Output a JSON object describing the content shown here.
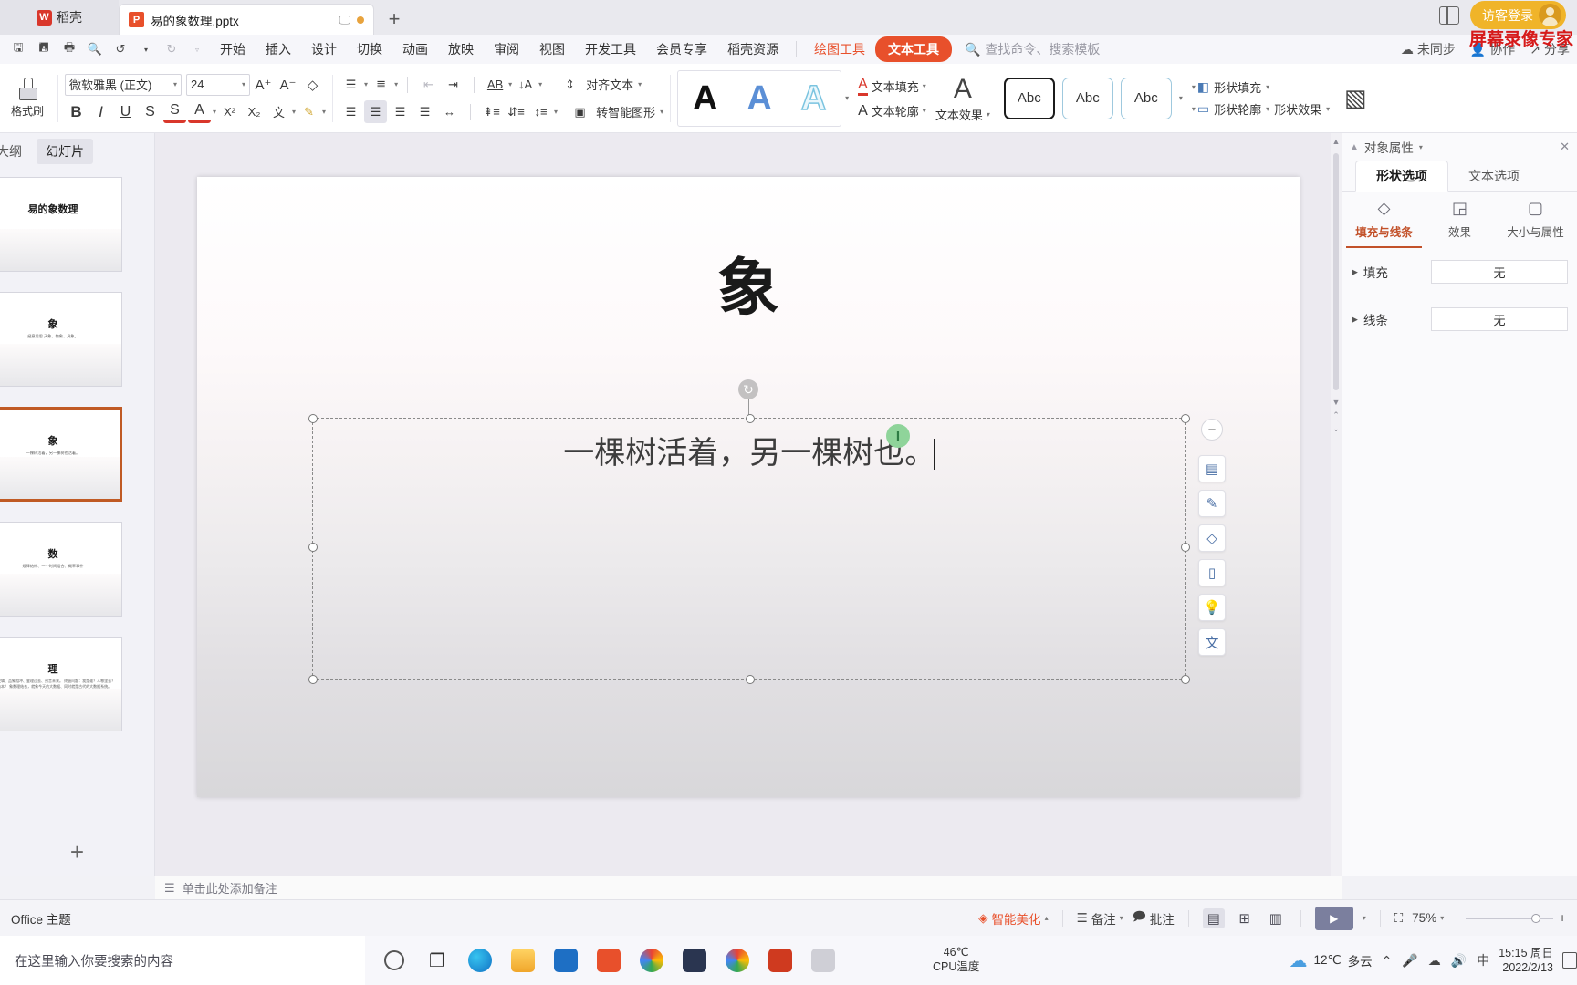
{
  "titlebar": {
    "home_label": "稻壳",
    "home_icon": "wps-logo-icon",
    "tab_name": "易的象数理.pptx",
    "tab_icon": "powerpoint-file-icon",
    "monitor_icon": "monitor-icon",
    "new_tab": "+",
    "panel_icon": "side-panel-icon",
    "login_label": "访客登录",
    "watermark": "屏幕录像专家"
  },
  "menubar": {
    "quick": [
      "save-icon",
      "save-as-icon",
      "print-icon",
      "print-preview-icon",
      "undo-icon",
      "redo-icon",
      "customize-icon"
    ],
    "items": [
      "开始",
      "插入",
      "设计",
      "切换",
      "动画",
      "放映",
      "审阅",
      "视图",
      "开发工具",
      "会员专享",
      "稻壳资源"
    ],
    "context_tabs": [
      {
        "label": "绘图工具",
        "style": "orange"
      },
      {
        "label": "文本工具",
        "style": "pill"
      }
    ],
    "search_placeholder": "查找命令、搜索模板",
    "right": [
      {
        "label": "未同步",
        "icon": "cloud-sync-icon"
      },
      {
        "label": "协作",
        "icon": "collaborate-icon"
      },
      {
        "label": "分享",
        "icon": "share-icon"
      }
    ]
  },
  "ribbon": {
    "format_painter": "格式刷",
    "font_name": "微软雅黑 (正文)",
    "font_size": "24",
    "font_buttons": [
      "A+",
      "A-",
      "clear-format-icon"
    ],
    "style_buttons": [
      "B",
      "I",
      "U",
      "S",
      "A",
      "X²",
      "X₂",
      "wen-icon",
      "highlight-icon"
    ],
    "list_buttons": [
      "bullet-list-icon",
      "number-list-icon",
      "decrease-indent-icon",
      "increase-indent-icon",
      "text-direction-icon",
      "sort-icon"
    ],
    "align_buttons": [
      "align-left-icon",
      "align-center-icon",
      "align-right-icon",
      "justify-icon",
      "distribute-icon",
      "line-spacing-icon",
      "para-spacing-icon",
      "line-height-icon"
    ],
    "align_text_label": "对齐文本",
    "smartart_label": "转智能图形",
    "wordart_samples": [
      "A",
      "A",
      "A"
    ],
    "text_fill_label": "文本填充",
    "text_outline_label": "文本轮廓",
    "text_effect_label": "文本效果",
    "shape_styles": [
      "Abc",
      "Abc",
      "Abc"
    ],
    "shape_fill_label": "形状填充",
    "shape_outline_label": "形状轮廓",
    "shape_effect_label": "形状效果",
    "picture_label": "picture-effects-icon"
  },
  "left_panel": {
    "tabs": [
      {
        "label": "大纲",
        "active": false
      },
      {
        "label": "幻灯片",
        "active": true
      }
    ],
    "slides": [
      {
        "title": "易的象数理",
        "sub": "",
        "selected": false
      },
      {
        "title": "象",
        "sub": "经意思思\n天象、物象、具象。",
        "selected": false
      },
      {
        "title": "象",
        "sub": "一棵树活着，另一棵树也活着。",
        "selected": true
      },
      {
        "title": "数",
        "sub": "规律结构、一个时间组合、概率事件",
        "selected": false
      },
      {
        "title": "理",
        "sub": "规律逻辑、品象相冲、鉴理过去、预言未来。\n终极问题：我是谁？人哪里去？何处为本？\n象数理结合，就象今天的大数据、同时就是古代的大数据系统。",
        "selected": false
      }
    ],
    "add_slide": "+"
  },
  "slide": {
    "title": "象",
    "body_text": "一棵树活着，另一棵树也。",
    "ibeam_icon": "text-cursor-icon",
    "float_tools": [
      "minus-icon",
      "layers-icon",
      "pen-icon",
      "shape-fill-icon",
      "align-icon",
      "idea-icon",
      "translate-icon"
    ]
  },
  "right_panel": {
    "title": "对象属性",
    "tabs": [
      {
        "label": "形状选项",
        "active": true
      },
      {
        "label": "文本选项",
        "active": false
      }
    ],
    "subtabs": [
      {
        "label": "填充与线条",
        "icon": "fill-line-icon",
        "active": true
      },
      {
        "label": "效果",
        "icon": "effects-icon",
        "active": false
      },
      {
        "label": "大小与属性",
        "icon": "size-props-icon",
        "active": false
      }
    ],
    "rows": [
      {
        "label": "填充",
        "value": "无"
      },
      {
        "label": "线条",
        "value": "无"
      }
    ]
  },
  "notes": {
    "icon": "notes-icon",
    "placeholder": "单击此处添加备注"
  },
  "statusbar": {
    "theme": "Office 主题",
    "beautify": "智能美化",
    "notes_btn": "备注",
    "comment_btn": "批注",
    "view_icons": [
      "normal-view-icon",
      "slide-sorter-icon",
      "reading-view-icon"
    ],
    "play_icon": "play-icon",
    "fit_icon": "fit-slide-icon",
    "zoom": "75%",
    "zoom_out": "−",
    "zoom_in": "+"
  },
  "taskbar": {
    "search_placeholder": "在这里输入你要搜索的内容",
    "icons": [
      "cortana-icon",
      "task-view-icon",
      "edge-icon",
      "explorer-icon",
      "mail-icon",
      "wps-icon",
      "chrome-color-icon",
      "cat-icon",
      "chrome-icon",
      "wps-writer-icon",
      "folder-icon"
    ],
    "cpu_temp": "46℃",
    "cpu_label": "CPU温度",
    "weather_temp": "12℃",
    "weather_desc": "多云",
    "tray": [
      "chevron-up-icon",
      "mic-icon",
      "cloud-icon",
      "speaker-icon",
      "ime-cn-icon"
    ],
    "ime": "中",
    "time": "15:15 周日",
    "date": "2022/2/13",
    "notify_icon": "notification-icon"
  },
  "colors": {
    "accent_orange": "#e8502b",
    "login_yellow": "#f0b429",
    "selected_slide": "#c05a24",
    "panel_active": "#c2512a"
  }
}
